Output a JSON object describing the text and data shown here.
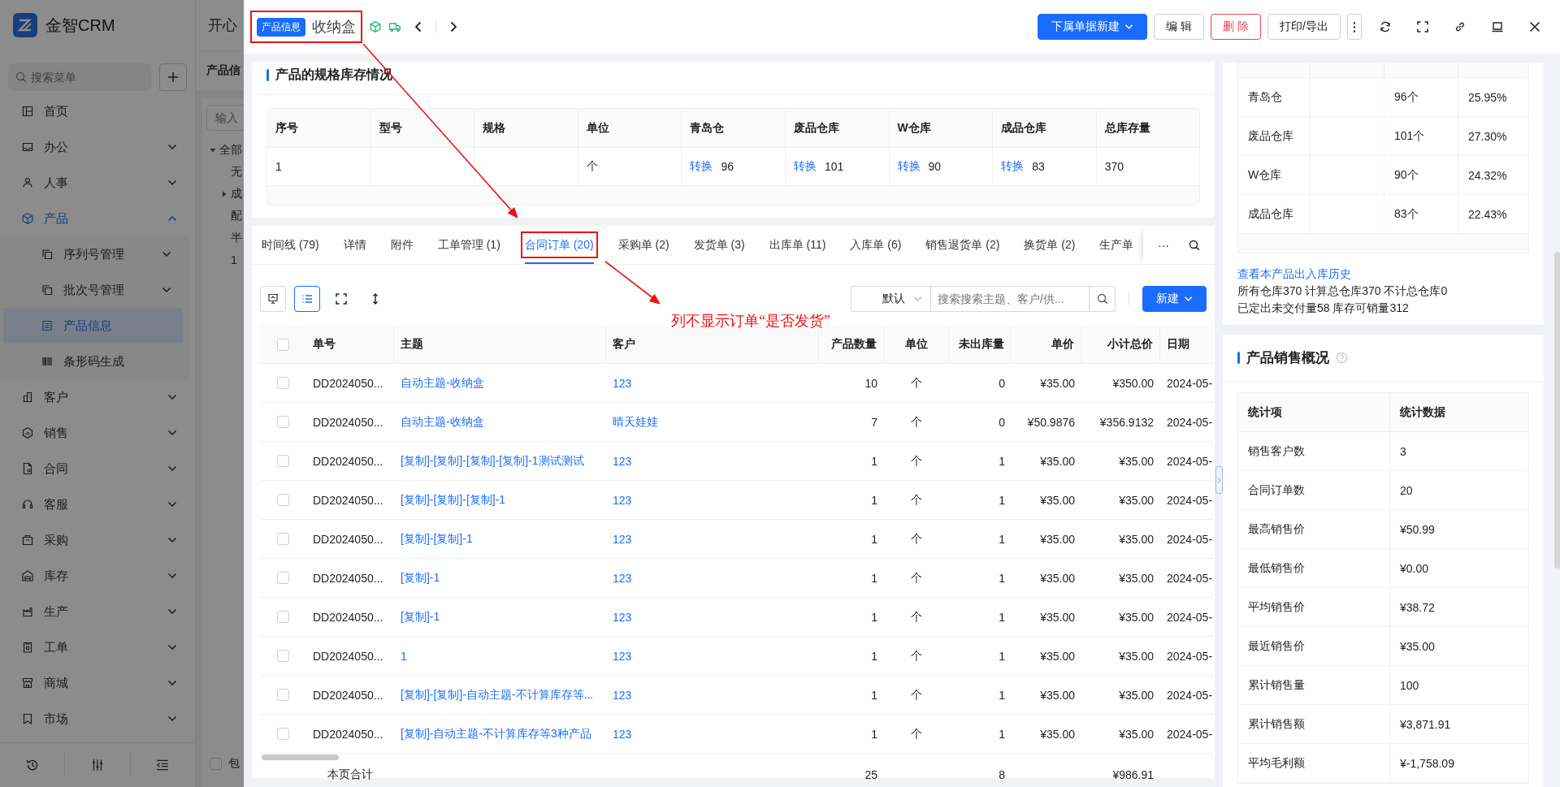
{
  "app": {
    "logo_text": "金智CRM",
    "header_text": "开心",
    "search_placeholder": "搜索菜单"
  },
  "menu": [
    {
      "label": "首页",
      "expandable": false,
      "selected": false
    },
    {
      "label": "办公",
      "expandable": true,
      "expanded": false,
      "selected": false
    },
    {
      "label": "人事",
      "expandable": true,
      "expanded": false,
      "selected": false
    },
    {
      "label": "产品",
      "expandable": true,
      "expanded": true,
      "selected": false,
      "children": [
        {
          "label": "序列号管理",
          "expandable": true,
          "expanded": false,
          "selected": false
        },
        {
          "label": "批次号管理",
          "expandable": true,
          "expanded": false,
          "selected": false
        },
        {
          "label": "产品信息",
          "expandable": false,
          "selected": true
        },
        {
          "label": "条形码生成",
          "expandable": false,
          "selected": false
        }
      ]
    },
    {
      "label": "客户",
      "expandable": true,
      "expanded": false,
      "selected": false
    },
    {
      "label": "销售",
      "expandable": true,
      "expanded": false,
      "selected": false
    },
    {
      "label": "合同",
      "expandable": true,
      "expanded": false,
      "selected": false
    },
    {
      "label": "客服",
      "expandable": true,
      "expanded": false,
      "selected": false
    },
    {
      "label": "采购",
      "expandable": true,
      "expanded": false,
      "selected": false
    },
    {
      "label": "库存",
      "expandable": true,
      "expanded": false,
      "selected": false
    },
    {
      "label": "生产",
      "expandable": true,
      "expanded": false,
      "selected": false
    },
    {
      "label": "工单",
      "expandable": true,
      "expanded": false,
      "selected": false
    },
    {
      "label": "商城",
      "expandable": true,
      "expanded": false,
      "selected": false
    },
    {
      "label": "市场",
      "expandable": true,
      "expanded": false,
      "selected": false
    }
  ],
  "background_page": {
    "title": "产品信",
    "search_placeholder": "输入",
    "tree": [
      {
        "label": "全部",
        "expanded": true,
        "children": [
          {
            "label": "无"
          },
          {
            "label": "成",
            "expanded": false
          },
          {
            "label": "配"
          },
          {
            "label": "半"
          },
          {
            "label": "1"
          }
        ]
      }
    ],
    "checkbox": {
      "label": "包",
      "checked": false
    }
  },
  "drawer": {
    "header": {
      "badge": "产品信息",
      "title": "收纳盒",
      "annotated": true
    },
    "actions": [
      {
        "label": "下属单据新建",
        "kind": "primary-dropdown"
      },
      {
        "label": "编 辑",
        "kind": "default"
      },
      {
        "label": "删 除",
        "kind": "danger"
      },
      {
        "label": "打印/导出",
        "kind": "default"
      }
    ]
  },
  "spec_stock": {
    "title": "产品的规格库存情况",
    "columns": [
      "序号",
      "型号",
      "规格",
      "单位",
      "青岛仓",
      "废品仓库",
      "W仓库",
      "成品仓库",
      "总库存量"
    ],
    "rows": [
      {
        "index": "1",
        "unit": "个",
        "warehouses": [
          {
            "link": "转换",
            "value": "96"
          },
          {
            "link": "转换",
            "value": "101"
          },
          {
            "link": "转换",
            "value": "90"
          },
          {
            "link": "转换",
            "value": "83"
          }
        ],
        "total": "370"
      }
    ]
  },
  "tabs": [
    {
      "label": "时间线 (79)",
      "selected": false,
      "annotated": false
    },
    {
      "label": "详情",
      "selected": false,
      "annotated": false
    },
    {
      "label": "附件",
      "selected": false,
      "annotated": false
    },
    {
      "label": "工单管理 (1)",
      "selected": false,
      "annotated": false
    },
    {
      "label": "合同订单 (20)",
      "selected": true,
      "annotated": true
    },
    {
      "label": "采购单 (2)",
      "selected": false,
      "annotated": false
    },
    {
      "label": "发货单 (3)",
      "selected": false,
      "annotated": false
    },
    {
      "label": "出库单 (11)",
      "selected": false,
      "annotated": false
    },
    {
      "label": "入库单 (6)",
      "selected": false,
      "annotated": false
    },
    {
      "label": "销售退货单 (2)",
      "selected": false,
      "annotated": false
    },
    {
      "label": "换货单 (2)",
      "selected": false,
      "annotated": false
    },
    {
      "label": "生产单",
      "selected": false,
      "annotated": false
    }
  ],
  "tabs_more": "···",
  "orders": {
    "view_modes": [
      {
        "selected": false
      },
      {
        "selected": true
      }
    ],
    "sort": "默认",
    "search_placeholder": "搜索搜索主题、客户/供...",
    "new_button": "新建",
    "header_checked": false,
    "columns": [
      "单号",
      "主题",
      "客户",
      "产品数量",
      "单位",
      "未出库量",
      "单价",
      "小计总价",
      "日期"
    ],
    "rows": [
      {
        "checked": false,
        "number": "DD2024050...",
        "subject": "自动主题-收纳盒",
        "customer": "123",
        "quantity": "10",
        "unit": "个",
        "unshipped": "0",
        "unit_price": "¥35.00",
        "subtotal": "¥350.00",
        "date": "2024-05-"
      },
      {
        "checked": false,
        "number": "DD2024050...",
        "subject": "自动主题-收纳盒",
        "customer": "晴天娃娃",
        "quantity": "7",
        "unit": "个",
        "unshipped": "0",
        "unit_price": "¥50.9876",
        "subtotal": "¥356.9132",
        "date": "2024-05-"
      },
      {
        "checked": false,
        "number": "DD2024050...",
        "subject": "[复制]-[复制]-[复制]-[复制]-1测试测试",
        "customer": "123",
        "quantity": "1",
        "unit": "个",
        "unshipped": "1",
        "unit_price": "¥35.00",
        "subtotal": "¥35.00",
        "date": "2024-05-"
      },
      {
        "checked": false,
        "number": "DD2024050...",
        "subject": "[复制]-[复制]-[复制]-1",
        "customer": "123",
        "quantity": "1",
        "unit": "个",
        "unshipped": "1",
        "unit_price": "¥35.00",
        "subtotal": "¥35.00",
        "date": "2024-05-"
      },
      {
        "checked": false,
        "number": "DD2024050...",
        "subject": "[复制]-[复制]-1",
        "customer": "123",
        "quantity": "1",
        "unit": "个",
        "unshipped": "1",
        "unit_price": "¥35.00",
        "subtotal": "¥35.00",
        "date": "2024-05-"
      },
      {
        "checked": false,
        "number": "DD2024050...",
        "subject": "[复制]-1",
        "customer": "123",
        "quantity": "1",
        "unit": "个",
        "unshipped": "1",
        "unit_price": "¥35.00",
        "subtotal": "¥35.00",
        "date": "2024-05-"
      },
      {
        "checked": false,
        "number": "DD2024050...",
        "subject": "[复制]-1",
        "customer": "123",
        "quantity": "1",
        "unit": "个",
        "unshipped": "1",
        "unit_price": "¥35.00",
        "subtotal": "¥35.00",
        "date": "2024-05-"
      },
      {
        "checked": false,
        "number": "DD2024050...",
        "subject": "1",
        "customer": "123",
        "quantity": "1",
        "unit": "个",
        "unshipped": "1",
        "unit_price": "¥35.00",
        "subtotal": "¥35.00",
        "date": "2024-05-"
      },
      {
        "checked": false,
        "number": "DD2024050...",
        "subject": "[复制]-[复制]-自动主题-不计算库存等...",
        "customer": "123",
        "quantity": "1",
        "unit": "个",
        "unshipped": "1",
        "unit_price": "¥35.00",
        "subtotal": "¥35.00",
        "date": "2024-05-"
      },
      {
        "checked": false,
        "number": "DD2024050...",
        "subject": "[复制]-自动主题-不计算库存等3种产品",
        "customer": "123",
        "quantity": "1",
        "unit": "个",
        "unshipped": "1",
        "unit_price": "¥35.00",
        "subtotal": "¥35.00",
        "date": "2024-05-"
      }
    ],
    "totals": {
      "label": "本页合计",
      "quantity": "25",
      "unshipped": "8",
      "subtotal": "¥986.91"
    }
  },
  "annotation": {
    "note": "列不显示订单“是否发货”"
  },
  "stock_distribution": {
    "rows": [
      {
        "warehouse": "青岛仓",
        "quantity": "96个",
        "share": "25.95%"
      },
      {
        "warehouse": "废品仓库",
        "quantity": "101个",
        "share": "27.30%"
      },
      {
        "warehouse": "W仓库",
        "quantity": "90个",
        "share": "24.32%"
      },
      {
        "warehouse": "成品仓库",
        "quantity": "83个",
        "share": "22.43%"
      }
    ],
    "history_link": "查看本产品出入库历史",
    "summary_lines": [
      "所有仓库370 计算总仓库370 不计总仓库0",
      "已定出未交付量58 库存可销量312"
    ]
  },
  "sales_overview": {
    "title": "产品销售概况",
    "columns": [
      "统计项",
      "统计数据"
    ],
    "rows": [
      {
        "item": "销售客户数",
        "value": "3"
      },
      {
        "item": "合同订单数",
        "value": "20"
      },
      {
        "item": "最高销售价",
        "value": "¥50.99"
      },
      {
        "item": "最低销售价",
        "value": "¥0.00"
      },
      {
        "item": "平均销售价",
        "value": "¥38.72"
      },
      {
        "item": "最近销售价",
        "value": "¥35.00"
      },
      {
        "item": "累计销售量",
        "value": "100"
      },
      {
        "item": "累计销售额",
        "value": "¥3,871.91"
      },
      {
        "item": "平均毛利额",
        "value": "¥-1,758.09"
      }
    ]
  }
}
